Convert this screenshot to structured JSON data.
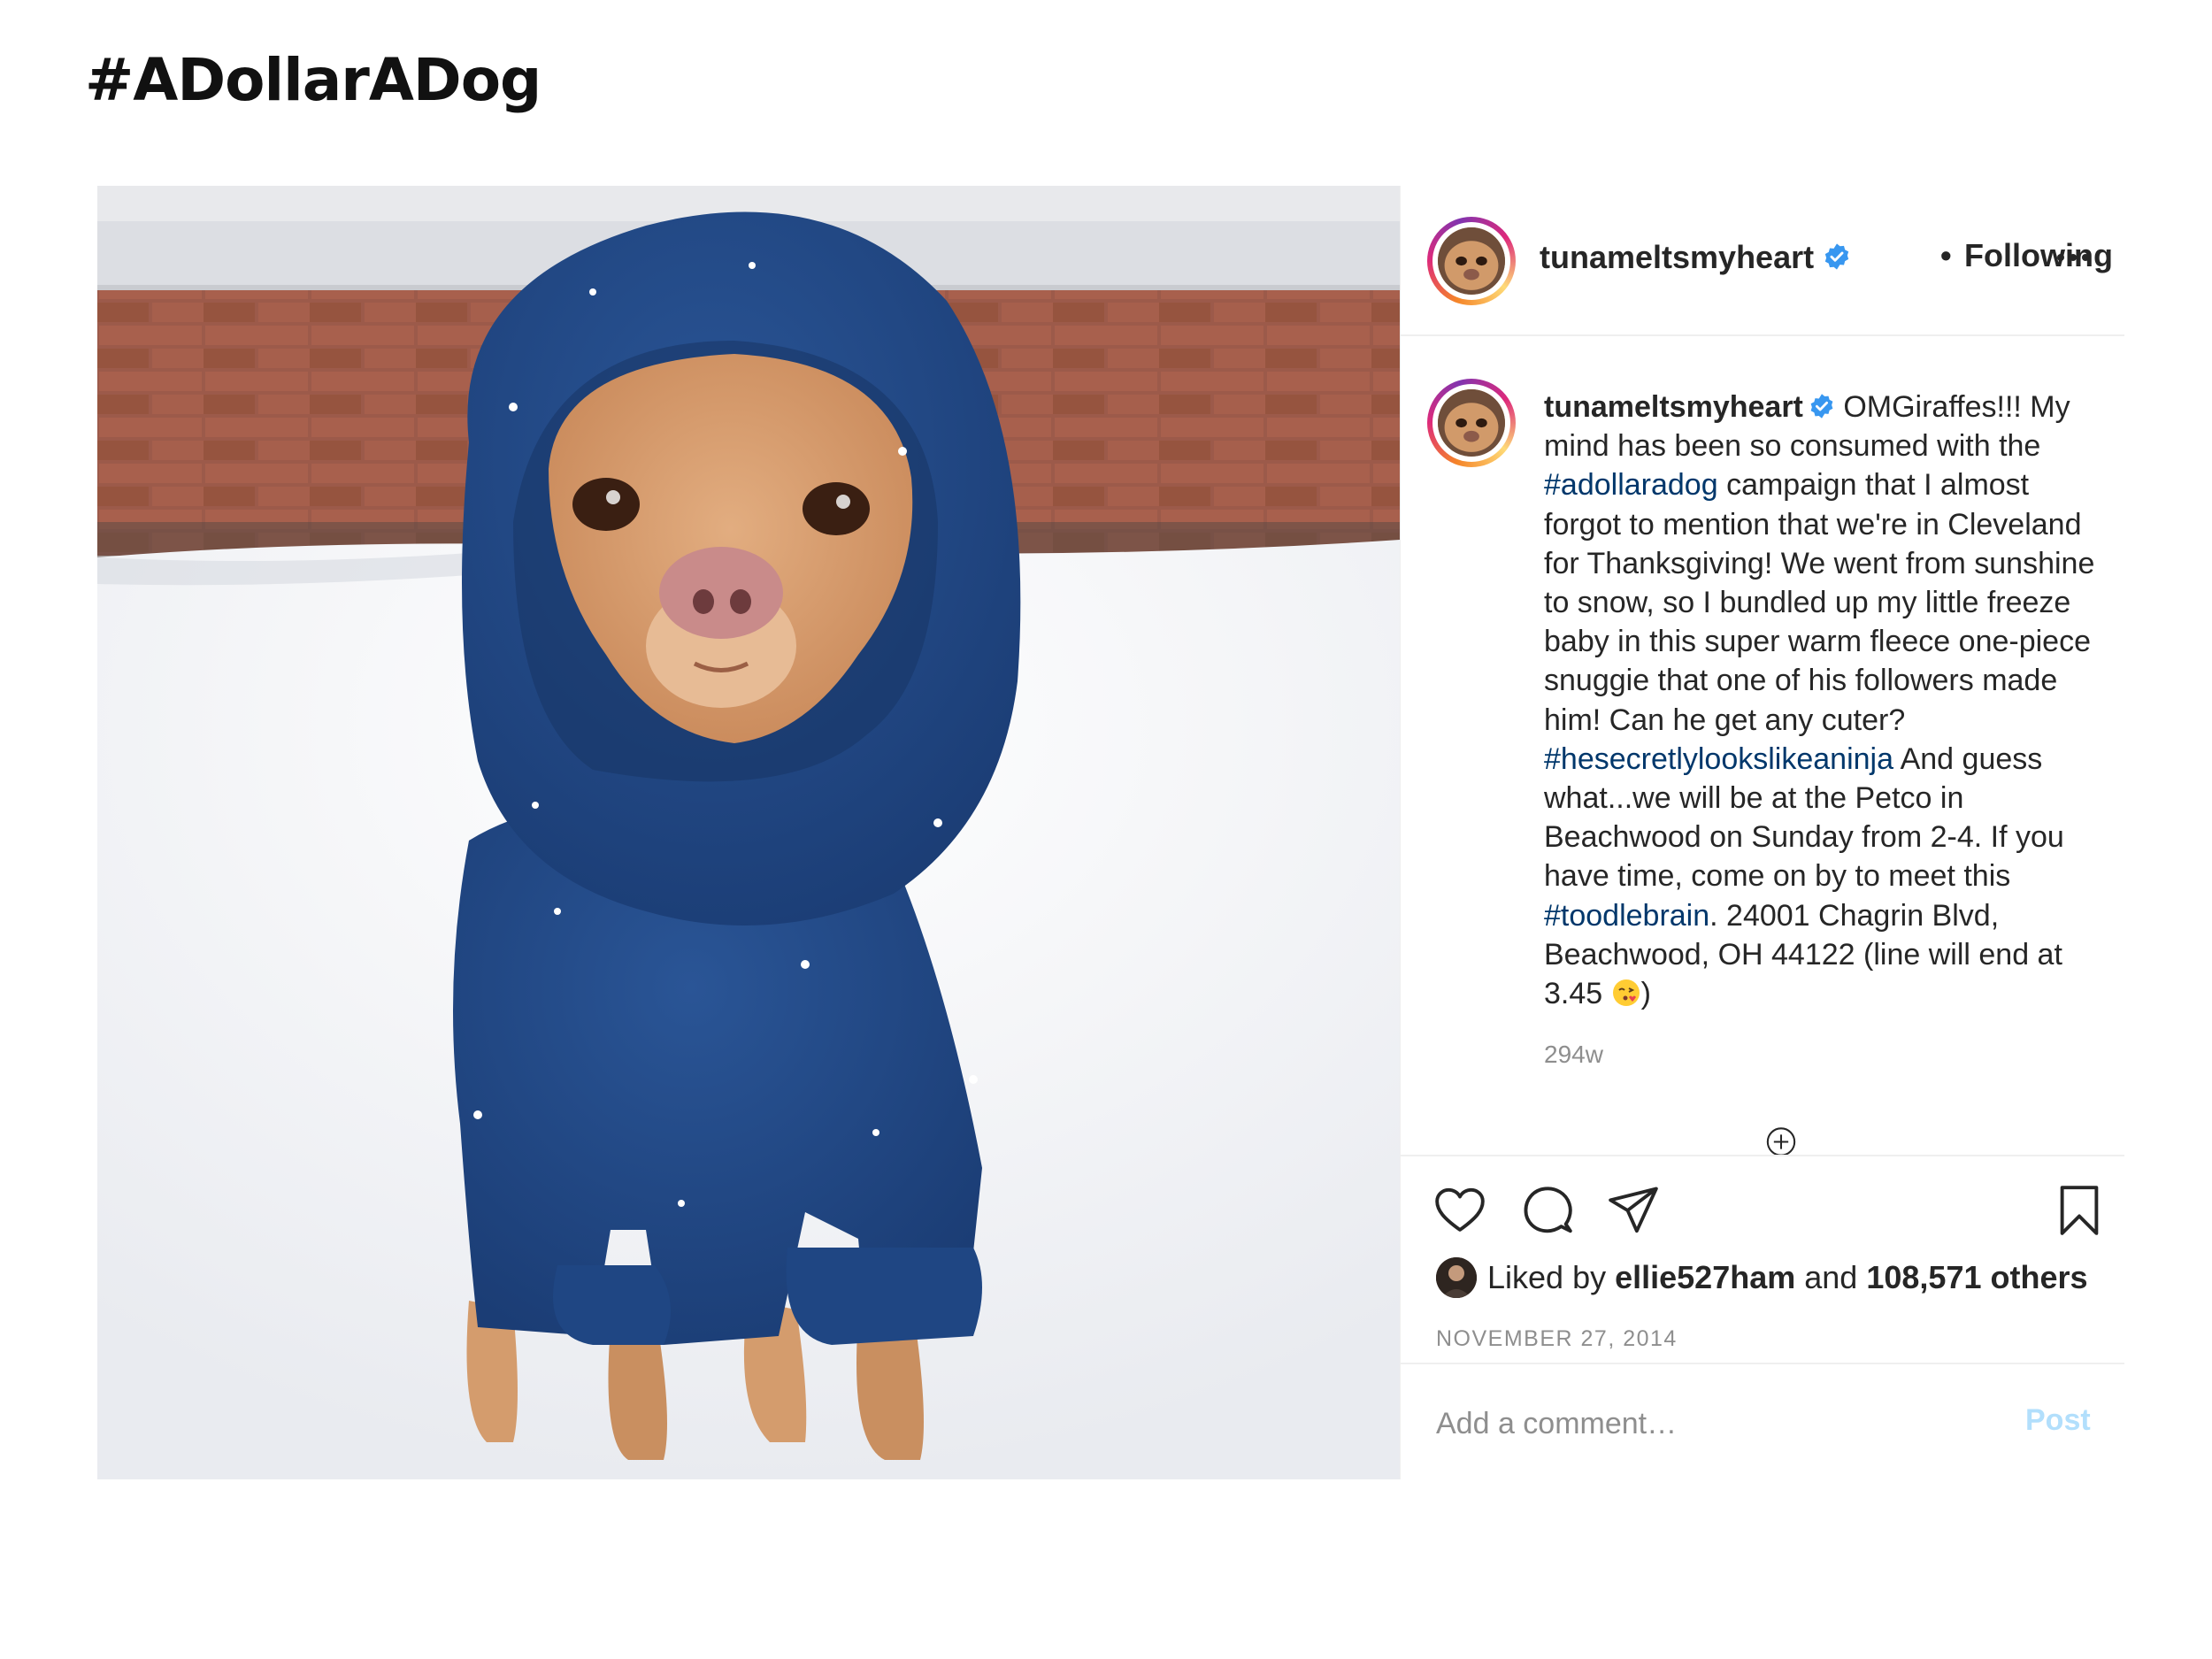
{
  "page": {
    "title": "#ADollarADog"
  },
  "post": {
    "username": "tunameltsmyheart",
    "verified": true,
    "follow_separator": "•",
    "follow_status": "Following",
    "more_icon": "ellipsis-icon",
    "caption": {
      "username": "tunameltsmyheart",
      "seg1": " OMGiraffes!!! My mind has been so consumed with the ",
      "tag1": "#adollaradog",
      "seg2": " campaign that I almost forgot to mention that we're in Cleveland for Thanksgiving! We went from sunshine to snow, so I bundled up my little freeze baby in this super warm fleece one-piece snuggie that one of his followers made him! Can he get any cuter? ",
      "tag2": "#hesecretlylookslikeaninja",
      "seg3": " And guess what...we will be at the Petco in Beachwood on Sunday from 2-4. If you have time, come on by to meet this ",
      "tag3": "#toodlebrain",
      "seg4": ". 24001 Chagrin Blvd, Beachwood, OH 44122 (line will end at 3.45 ",
      "emoji": "kissing-face-emoji",
      "seg5": ")"
    },
    "age": "294w",
    "likes": {
      "prefix": "Liked by ",
      "user": "ellie527ham",
      "middle": " and ",
      "count": "108,571 others"
    },
    "date": "NOVEMBER 27, 2014",
    "comment": {
      "placeholder": "Add a comment…",
      "post_label": "Post"
    },
    "colors": {
      "link": "#00376b",
      "verified": "#3897f0",
      "post_disabled": "#b2dffc",
      "muted": "#8e8e8e"
    }
  }
}
